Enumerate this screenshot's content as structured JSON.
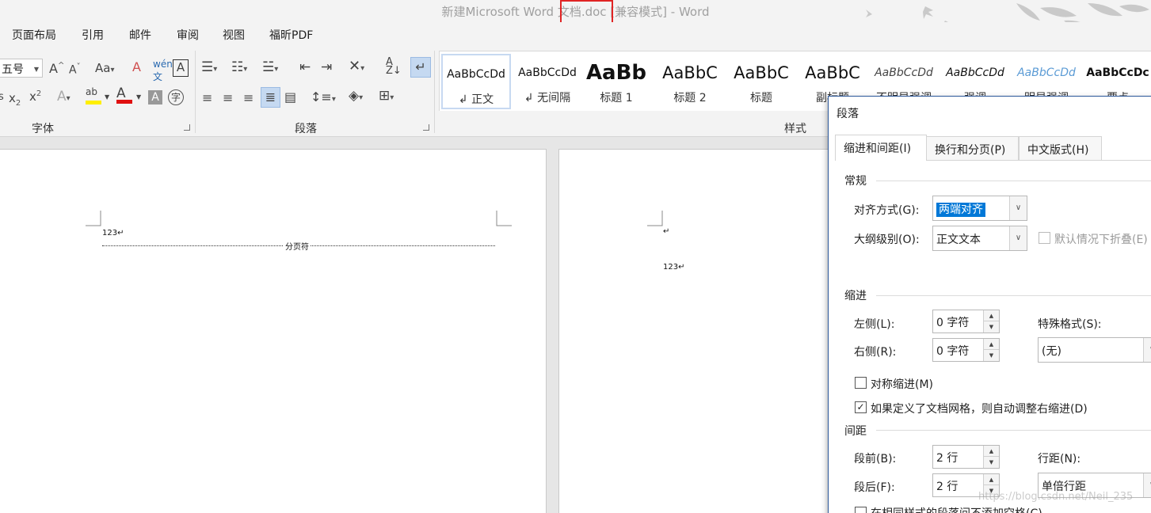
{
  "window": {
    "title": "新建Microsoft Word 文档.doc [兼容模式] - Word"
  },
  "tabs": [
    "页面布局",
    "引用",
    "邮件",
    "审阅",
    "视图",
    "福昕PDF"
  ],
  "ribbon": {
    "font_group": {
      "label": "字体",
      "font_size": "五号"
    },
    "paragraph_group": {
      "label": "段落"
    },
    "styles_group": {
      "label": "样式"
    }
  },
  "styles": [
    {
      "sample": "AaBbCcDd",
      "name": "正文",
      "mark": "↲"
    },
    {
      "sample": "AaBbCcDd",
      "name": "无间隔",
      "mark": "↲"
    },
    {
      "sample": "AaBb",
      "name": "标题 1",
      "mark": ""
    },
    {
      "sample": "AaBbC",
      "name": "标题 2",
      "mark": ""
    },
    {
      "sample": "AaBbC",
      "name": "标题",
      "mark": ""
    },
    {
      "sample": "AaBbC",
      "name": "副标题",
      "mark": ""
    },
    {
      "sample": "AaBbCcDd",
      "name": "不明显强调",
      "mark": ""
    },
    {
      "sample": "AaBbCcDd",
      "name": "强调",
      "mark": ""
    },
    {
      "sample": "AaBbCcDd",
      "name": "明显强调",
      "mark": ""
    },
    {
      "sample": "AaBbCcDc",
      "name": "要点",
      "mark": ""
    }
  ],
  "document": {
    "page1_text": "123↵",
    "page_break_label": "分页符",
    "page2_mark": "↵",
    "page2_text": "123↵"
  },
  "dialog": {
    "title": "段落",
    "tabs": [
      "缩进和间距(I)",
      "换行和分页(P)",
      "中文版式(H)"
    ],
    "general": {
      "section": "常规",
      "alignment_label": "对齐方式(G):",
      "alignment_value": "两端对齐",
      "outline_label": "大纲级别(O):",
      "outline_value": "正文文本",
      "collapse_label": "默认情况下折叠(E)"
    },
    "indent": {
      "section": "缩进",
      "left_label": "左侧(L):",
      "left_value": "0 字符",
      "right_label": "右侧(R):",
      "right_value": "0 字符",
      "special_label": "特殊格式(S):",
      "special_value": "(无)",
      "mirror_label": "对称缩进(M)",
      "auto_adjust_label": "如果定义了文档网格，则自动调整右缩进(D)"
    },
    "spacing": {
      "section": "间距",
      "before_label": "段前(B):",
      "before_value": "2 行",
      "after_label": "段后(F):",
      "after_value": "2 行",
      "line_label": "行距(N):",
      "line_value": "单倍行距",
      "no_space_label": "在相同样式的段落间不添加空格(C)"
    }
  },
  "watermark": "https://blog.csdn.net/Neil_235"
}
